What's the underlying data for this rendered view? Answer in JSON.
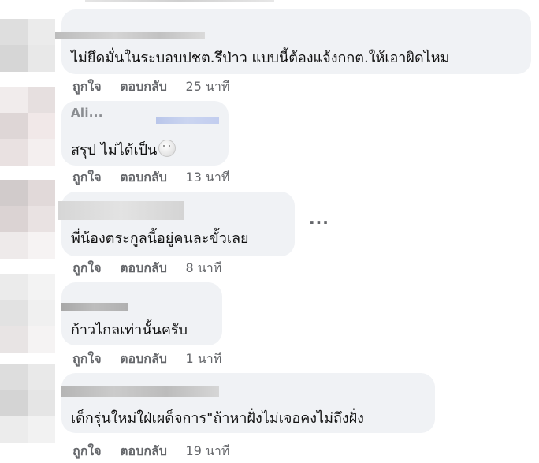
{
  "actions": {
    "like": "ถูกใจ",
    "reply": "ตอบกลับ"
  },
  "more_glyph": "···",
  "comments": [
    {
      "text": "ไม่ยึดมั่นในระบอบปชต.รึป่าว แบบนี้ต้องแจ้งกกต.ให้เอาผิดไหม",
      "time": "25 นาที"
    },
    {
      "author": "Ali...",
      "text": "สรุป ไม่ได้เป็น",
      "emoji": "neutral-face-icon",
      "time": "13 นาที"
    },
    {
      "text": "พี่น้องตระกูลนี้อยู่คนละขั้วเลย",
      "time": "8 นาที"
    },
    {
      "text": "ก้าวไกลเท่านั้นครับ",
      "time": "1 นาที"
    },
    {
      "text": "เด็กรุ่นใหม่ใฝ่เผด็จการ\"ถ้าหาฝั่งไม่เจอคงไม่ถึงฝั่ง",
      "time": "19 นาที"
    }
  ],
  "colors": {
    "bubble": "#f0f2f5",
    "meta": "#65676b",
    "text": "#050505"
  }
}
